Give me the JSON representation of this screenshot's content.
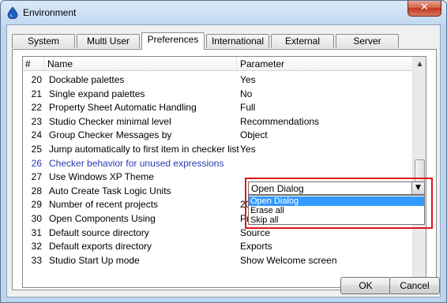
{
  "window": {
    "title": "Environment",
    "close_glyph": "✕"
  },
  "tabs": [
    {
      "label": "System"
    },
    {
      "label": "Multi User"
    },
    {
      "label": "Preferences",
      "active": true
    },
    {
      "label": "International"
    },
    {
      "label": "External"
    },
    {
      "label": "Server"
    }
  ],
  "list": {
    "columns": {
      "num": "#",
      "name": "Name",
      "param": "Parameter"
    },
    "rows": [
      {
        "num": "20",
        "name": "Dockable palettes",
        "param": "Yes"
      },
      {
        "num": "21",
        "name": "Single expand palettes",
        "param": "No"
      },
      {
        "num": "22",
        "name": "Property Sheet Automatic Handling",
        "param": "Full"
      },
      {
        "num": "23",
        "name": "Studio Checker minimal level",
        "param": "Recommendations"
      },
      {
        "num": "24",
        "name": "Group Checker Messages by",
        "param": "Object"
      },
      {
        "num": "25",
        "name": "Jump automatically to first item in checker list",
        "param": "Yes"
      },
      {
        "num": "26",
        "name": "Checker behavior for unused expressions",
        "param": ""
      },
      {
        "num": "27",
        "name": "Use Windows XP Theme",
        "param": ""
      },
      {
        "num": "28",
        "name": "Auto Create Task Logic Units",
        "param": ""
      },
      {
        "num": "29",
        "name": "Number of recent projects",
        "param": "20"
      },
      {
        "num": "30",
        "name": "Open Components Using",
        "param": "Project"
      },
      {
        "num": "31",
        "name": "Default source directory",
        "param": "Source"
      },
      {
        "num": "32",
        "name": "Default exports directory",
        "param": "Exports"
      },
      {
        "num": "33",
        "name": "Studio Start Up mode",
        "param": "Show Welcome screen"
      }
    ]
  },
  "combo": {
    "value": "Open Dialog",
    "options": [
      "Open Dialog",
      "Erase all",
      "Skip all"
    ],
    "highlighted": "Open Dialog"
  },
  "buttons": {
    "ok": "OK",
    "cancel": "Cancel"
  },
  "colors": {
    "highlight": "#3399ff",
    "callout_border": "#e0141a",
    "selected_text": "#2b39b8"
  }
}
